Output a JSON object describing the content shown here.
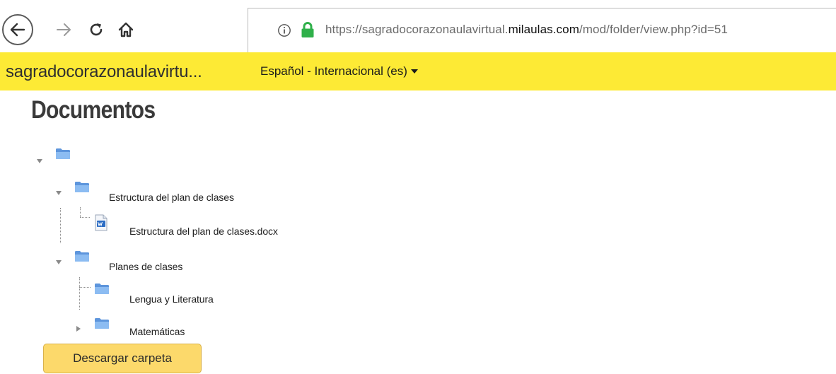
{
  "browser": {
    "url_prefix": "https://sagradocorazonaulavirtual.",
    "url_host": "milaulas.com",
    "url_suffix": "/mod/folder/view.php?id=51"
  },
  "site_nav": {
    "site_name": "sagradocorazonaulavirtu...",
    "language": "Español - Internacional (es)"
  },
  "page": {
    "title": "Documentos"
  },
  "tree": {
    "folder_1": "Estructura del plan de clases",
    "file_1": "Estructura del plan de clases.docx",
    "folder_2": "Planes de clases",
    "subfolder_1": "Lengua y Literatura",
    "subfolder_2": "Matemáticas"
  },
  "actions": {
    "download_label": "Descargar carpeta"
  },
  "colors": {
    "nav_background": "#fdea35",
    "button_background": "#fcd96b",
    "lock_green": "#2fb04a",
    "folder_blue": "#6fa4e8"
  },
  "icons": [
    "back-arrow-icon",
    "forward-arrow-icon",
    "reload-icon",
    "home-icon",
    "info-icon",
    "lock-icon",
    "caret-down-icon",
    "folder-icon",
    "word-document-icon",
    "triangle-down-icon",
    "triangle-right-icon"
  ]
}
